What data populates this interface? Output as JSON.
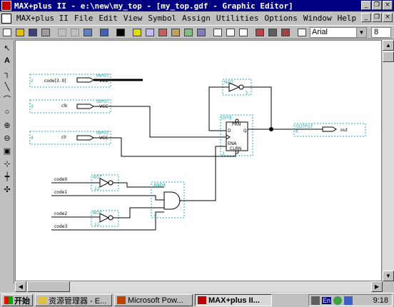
{
  "window": {
    "title": "MAX+plus II - e:\\new\\my_top - [my_top.gdf - Graphic Editor]",
    "minimize": "_",
    "restore": "❐",
    "close": "×"
  },
  "menu": [
    "MAX+plus II",
    "File",
    "Edit",
    "View",
    "Symbol",
    "Assign",
    "Utilities",
    "Options",
    "Window",
    "Help"
  ],
  "doc_buttons": {
    "minimize": "_",
    "restore": "❐",
    "close": "×"
  },
  "toolbar": {
    "font": "Arial",
    "font_size": "8"
  },
  "schematic": {
    "inputs": [
      {
        "name": "code[3..0]",
        "prim": "INPUT",
        "sub": "VCC",
        "num": "2"
      },
      {
        "name": "clk",
        "prim": "INPUT",
        "sub": "VCC",
        "num": "3"
      },
      {
        "name": "clr",
        "prim": "INPUT",
        "sub": "VCC",
        "num": "4"
      }
    ],
    "not_top": {
      "prim": "NOT",
      "num": "5"
    },
    "dff": {
      "prim": "DFFE",
      "prn": "PRN",
      "d": "D",
      "ena": "ENA",
      "clrn": "CLRN",
      "q": "Q",
      "num": "1"
    },
    "output": {
      "prim": "OUTPUT",
      "name": "out",
      "num": "6"
    },
    "signals": [
      "code0",
      "code1",
      "code2",
      "code3"
    ],
    "not_a": {
      "prim": "NOT",
      "num": "12"
    },
    "not_b": {
      "prim": "NOT",
      "num": "11"
    },
    "and4": {
      "prim": "AND4",
      "num": "7"
    }
  },
  "taskbar": {
    "start": "开始",
    "tasks": [
      "资源管理器 - E...",
      "Microsoft Pow...",
      "MAX+plus II..."
    ],
    "tray_lang": "En",
    "clock": "9:18"
  }
}
